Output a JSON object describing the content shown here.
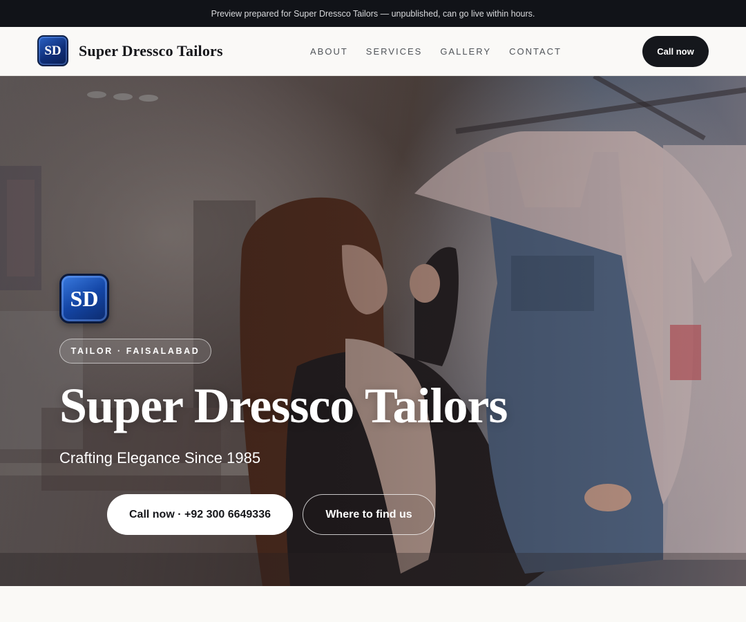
{
  "preview_bar": {
    "text": "Preview prepared for Super Dressco Tailors — unpublished, can go live within hours."
  },
  "header": {
    "logo_text": "SD",
    "brand_name": "Super Dressco Tailors",
    "nav": [
      {
        "label": "ABOUT"
      },
      {
        "label": "SERVICES"
      },
      {
        "label": "GALLERY"
      },
      {
        "label": "CONTACT"
      }
    ],
    "cta_label": "Call now"
  },
  "hero": {
    "logo_text": "SD",
    "tag": "TAILOR · FAISALABAD",
    "title": "Super Dressco Tailors",
    "subtitle": "Crafting Elegance Since 1985",
    "primary_button": "Call now · +92 300 6649336",
    "secondary_button": "Where to find us"
  },
  "colors": {
    "dark": "#111318",
    "header_bg": "#faf9f7",
    "logo_blue": "#1446a6",
    "button_dark": "#15171c"
  }
}
